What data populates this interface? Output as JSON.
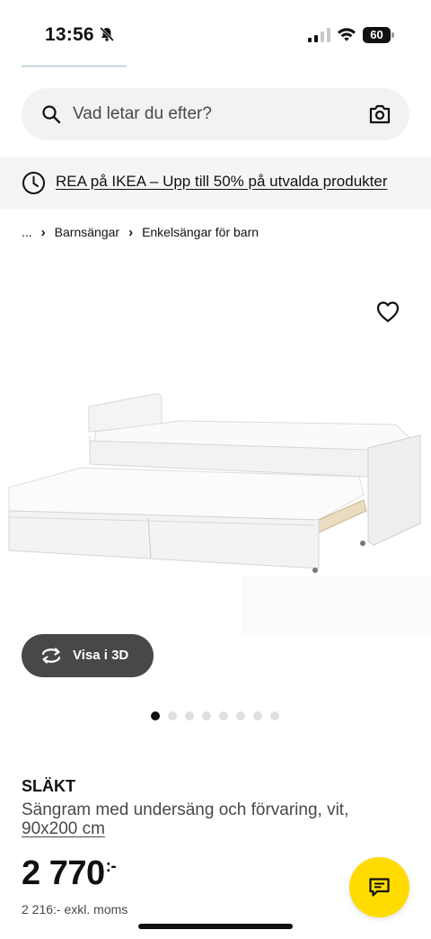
{
  "status_bar": {
    "time": "13:56",
    "battery": "60",
    "icons": [
      "bell-slash-icon",
      "signal-icon",
      "wifi-icon",
      "battery-icon"
    ]
  },
  "search": {
    "placeholder": "Vad letar du efter?",
    "icons": [
      "search-icon",
      "camera-icon"
    ]
  },
  "promo": {
    "text": "REA på IKEA – Upp till 50% på utvalda produkter",
    "icon": "clock-icon"
  },
  "breadcrumb": {
    "ellipsis": "...",
    "items": [
      "Barnsängar",
      "Enkelsängar för barn"
    ]
  },
  "gallery": {
    "view_3d_label": "Visa i 3D",
    "dot_count": 8,
    "active_dot": 0,
    "icons": [
      "heart-icon",
      "rotate-icon"
    ]
  },
  "product": {
    "name": "SLÄKT",
    "description": "Sängram med undersäng och förvaring, vit,",
    "size": "90x200 cm",
    "price": "2 770",
    "price_suffix": ":-",
    "price_excl_vat": "2 216:- exkl. moms"
  },
  "chat": {
    "icon": "chat-icon",
    "color": "#ffdb00"
  },
  "colors": {
    "accent_yellow": "#ffdb00",
    "button_dark": "#484848",
    "banner_bg": "#f5f5f5"
  }
}
